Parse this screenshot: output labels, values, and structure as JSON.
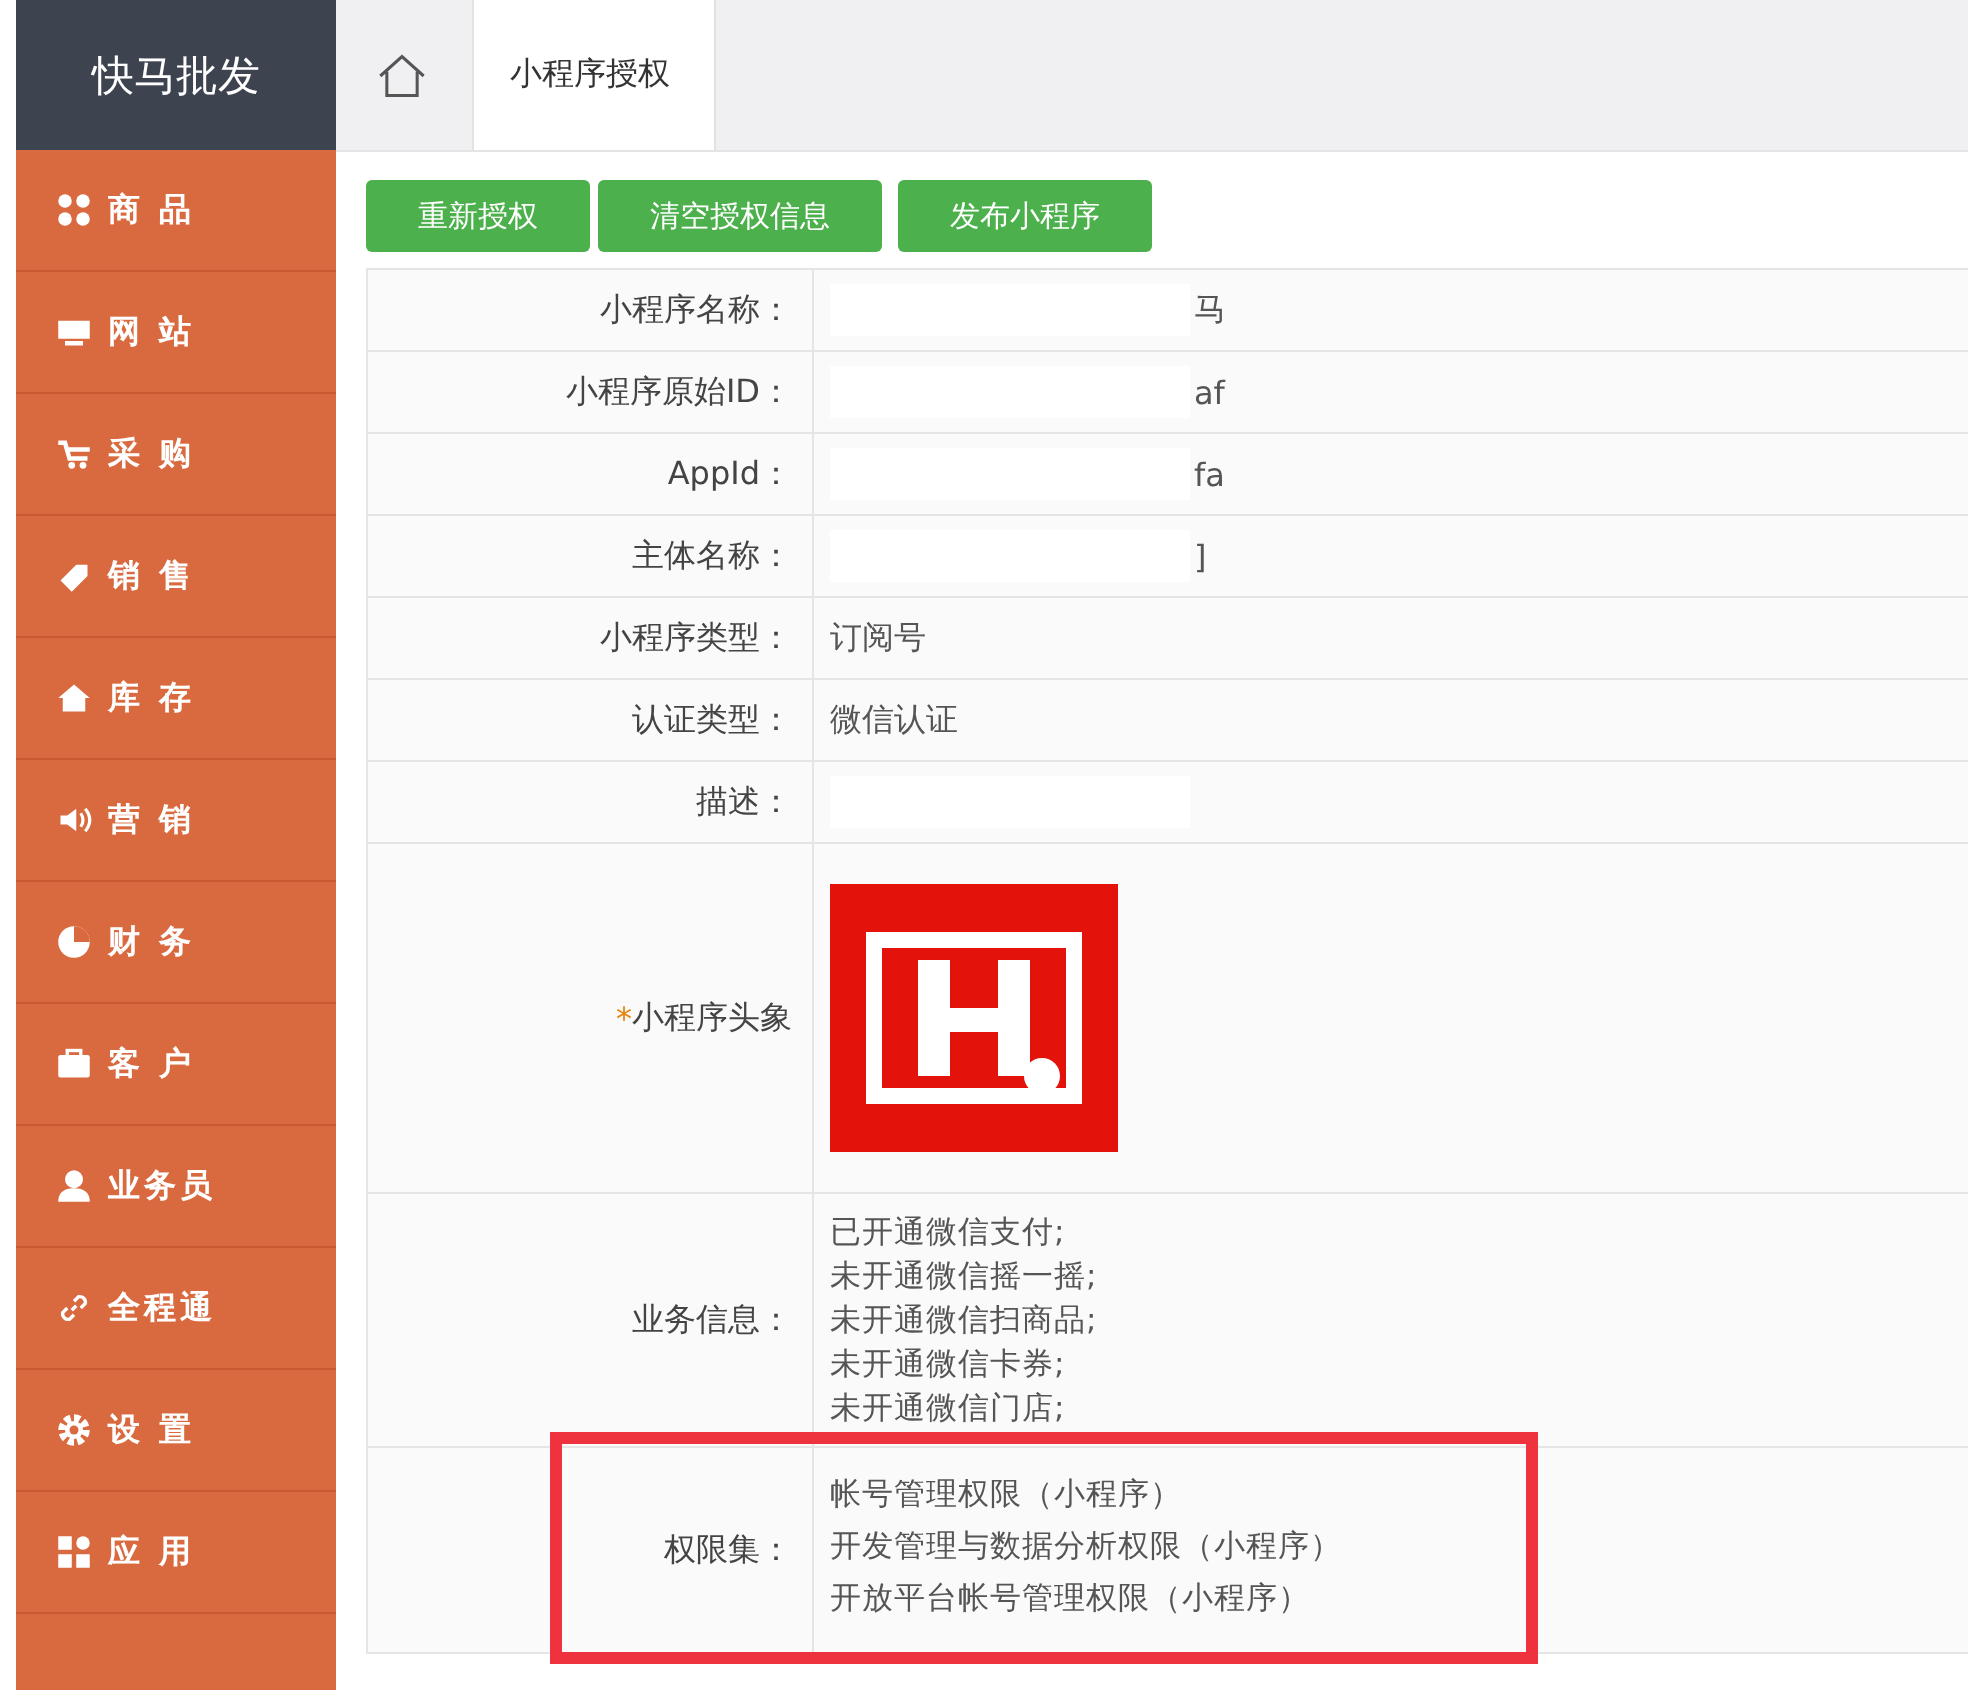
{
  "brand": "快马批发",
  "sidebar": {
    "items": [
      {
        "label": "商 品"
      },
      {
        "label": "网 站"
      },
      {
        "label": "采 购"
      },
      {
        "label": "销 售"
      },
      {
        "label": "库 存"
      },
      {
        "label": "营 销"
      },
      {
        "label": "财 务"
      },
      {
        "label": "客 户"
      },
      {
        "label": "业务员"
      },
      {
        "label": "全程通"
      },
      {
        "label": "设 置"
      },
      {
        "label": "应 用"
      }
    ]
  },
  "tabs": [
    {
      "label": "小程序授权",
      "selected": true
    }
  ],
  "buttons": [
    "重新授权",
    "清空授权信息",
    "发布小程序"
  ],
  "rows": [
    {
      "kind": "text",
      "label": "小程序名称：",
      "value": "马",
      "redacted": true
    },
    {
      "kind": "text",
      "label": "小程序原始ID：",
      "value": "af",
      "redacted": true
    },
    {
      "kind": "text",
      "label": "AppId：",
      "value": "fa",
      "redacted": true
    },
    {
      "kind": "text",
      "label": "主体名称：",
      "value": "]",
      "redacted": true
    },
    {
      "kind": "text",
      "label": "小程序类型：",
      "value": "订阅号"
    },
    {
      "kind": "text",
      "label": "认证类型：",
      "value": "微信认证"
    },
    {
      "kind": "text",
      "label": "描述：",
      "redacted": true
    },
    {
      "kind": "avatar",
      "label": "小程序头象",
      "required_mark": "*"
    },
    {
      "kind": "lines",
      "label": "业务信息：",
      "lines": [
        "已开通微信支付;",
        "未开通微信摇一摇;",
        "未开通微信扫商品;",
        "未开通微信卡券;",
        "未开通微信门店;"
      ]
    },
    {
      "kind": "lines",
      "label": "权限集：",
      "highlighted": true,
      "lines": [
        "帐号管理权限（小程序）",
        "开发管理与数据分析权限（小程序）",
        "开放平台帐号管理权限（小程序）"
      ]
    }
  ]
}
